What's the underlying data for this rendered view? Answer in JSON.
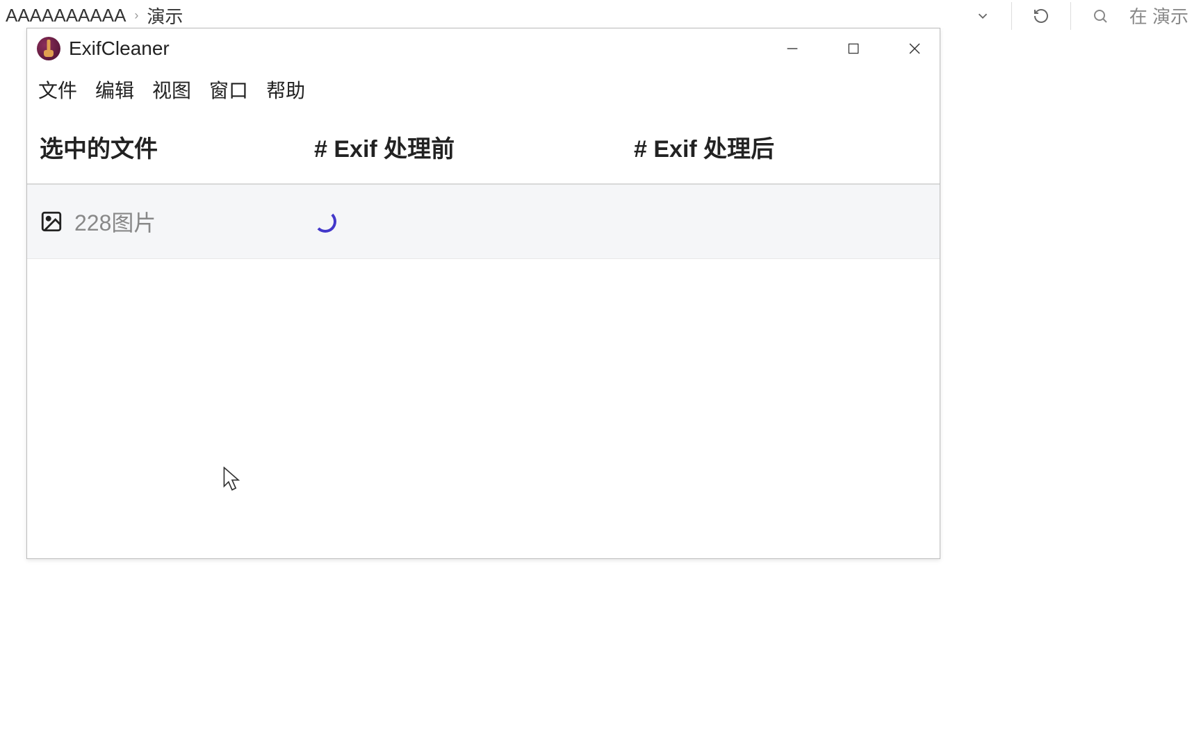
{
  "explorer": {
    "breadcrumb": {
      "segment1": "AAAAAAAAAA",
      "segment2": "演示"
    },
    "search_placeholder": "在 演示"
  },
  "app": {
    "title": "ExifCleaner",
    "menu": {
      "file": "文件",
      "edit": "编辑",
      "view": "视图",
      "window": "窗口",
      "help": "帮助"
    },
    "table": {
      "headers": {
        "selected_files": "选中的文件",
        "exif_before": "# Exif 处理前",
        "exif_after": "# Exif 处理后"
      },
      "rows": [
        {
          "filename": "228图片"
        }
      ]
    }
  }
}
